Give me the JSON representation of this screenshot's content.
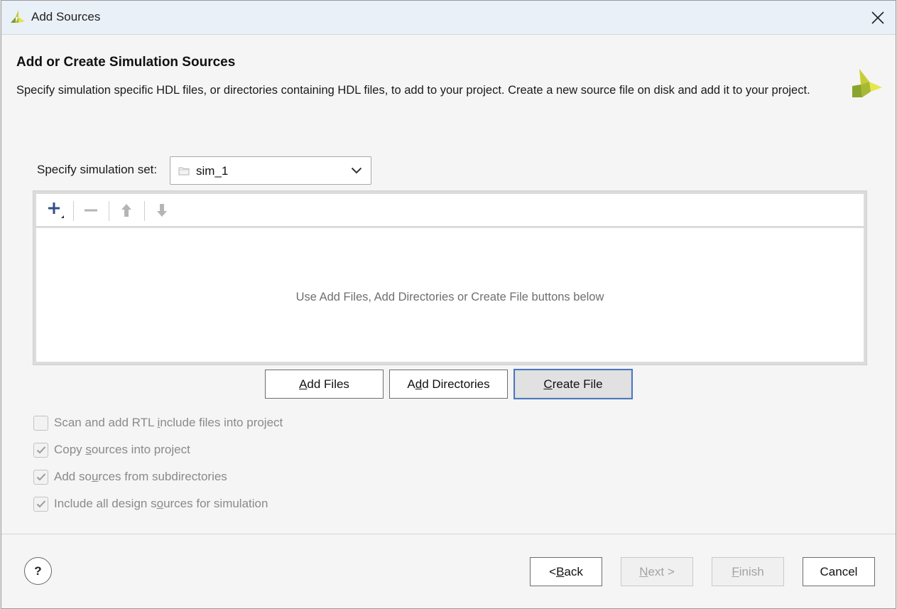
{
  "window": {
    "title": "Add Sources"
  },
  "header": {
    "title": "Add or Create Simulation Sources",
    "description": "Specify simulation specific HDL files, or directories containing HDL files, to add to your project. Create a new source file on disk and add it to your project."
  },
  "simulation_set": {
    "label": "Specify simulation set:",
    "value": "sim_1"
  },
  "toolbar": {
    "add_icon": "plus-icon",
    "remove_icon": "minus-icon",
    "up_icon": "arrow-up-icon",
    "down_icon": "arrow-down-icon"
  },
  "file_list": {
    "empty_hint": "Use Add Files, Add Directories or Create File buttons below"
  },
  "file_buttons": {
    "add_files": {
      "mnemonic": "A",
      "rest": "dd Files"
    },
    "add_directories": {
      "pre": "A",
      "mnemonic": "d",
      "rest": "d Directories"
    },
    "create_file": {
      "mnemonic": "C",
      "rest": "reate File"
    }
  },
  "options": [
    {
      "pre": "Scan and add RTL ",
      "mnemonic": "i",
      "rest": "nclude files into project",
      "checked": false
    },
    {
      "pre": "Copy ",
      "mnemonic": "s",
      "rest": "ources into project",
      "checked": true
    },
    {
      "pre": "Add so",
      "mnemonic": "u",
      "rest": "rces from subdirectories",
      "checked": true
    },
    {
      "pre": "Include all design s",
      "mnemonic": "o",
      "rest": "urces for simulation",
      "checked": true
    }
  ],
  "footer": {
    "help_label": "?",
    "back": {
      "pre": "< ",
      "mnemonic": "B",
      "rest": "ack"
    },
    "next": {
      "mnemonic": "N",
      "rest": "ext >"
    },
    "finish": {
      "mnemonic": "F",
      "rest": "inish"
    },
    "cancel": "Cancel"
  },
  "colors": {
    "accent_focus": "#4a78c2",
    "logo_green": "#8fa832",
    "logo_yellow": "#d8de3c"
  }
}
